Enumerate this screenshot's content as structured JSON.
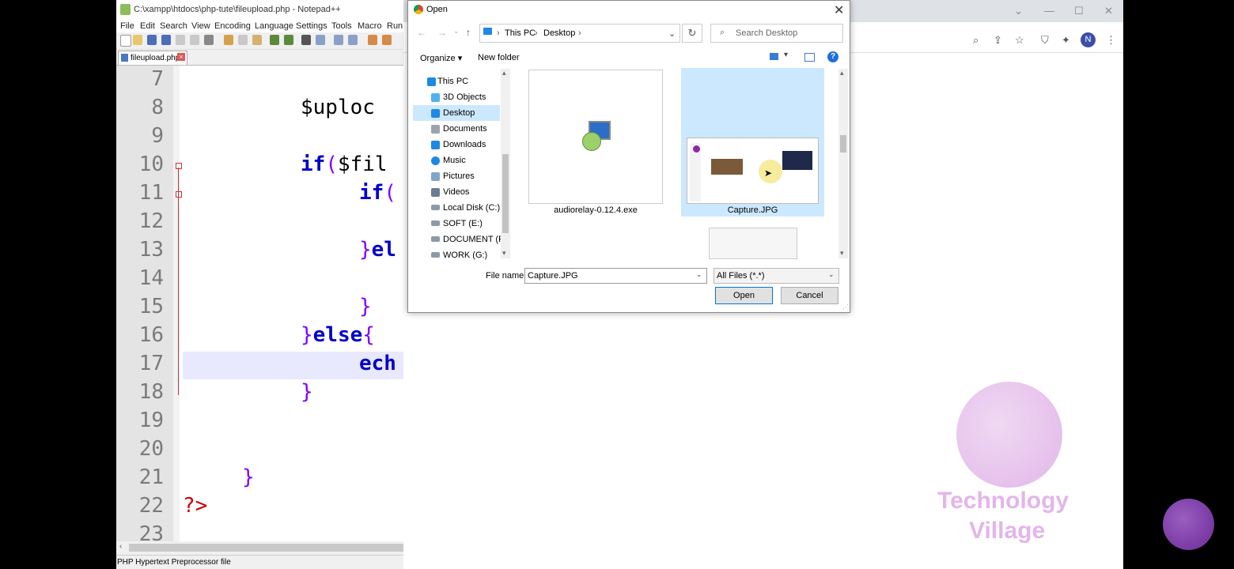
{
  "npp": {
    "title": "C:\\xampp\\htdocs\\php-tute\\fileupload.php - Notepad++",
    "menu": [
      "File",
      "Edit",
      "Search",
      "View",
      "Encoding",
      "Language",
      "Settings",
      "Tools",
      "Macro",
      "Run"
    ],
    "tab": "fileupload.php",
    "lines": [
      "7",
      "8",
      "9",
      "10",
      "11",
      "12",
      "13",
      "14",
      "15",
      "16",
      "17",
      "18",
      "19",
      "20",
      "21",
      "22",
      "23"
    ],
    "status": "PHP Hypertext Preprocessor file"
  },
  "chrome": {
    "avatar": "N"
  },
  "dialog": {
    "title": "Open",
    "breadcrumb": [
      "This PC",
      "Desktop"
    ],
    "search_placeholder": "Search Desktop",
    "organize": "Organize",
    "new_folder": "New folder",
    "sidebar": [
      "This PC",
      "3D Objects",
      "Desktop",
      "Documents",
      "Downloads",
      "Music",
      "Pictures",
      "Videos",
      "Local Disk (C:)",
      "SOFT (E:)",
      "DOCUMENT (F:)",
      "WORK (G:)"
    ],
    "files": [
      "audiorelay-0.12.4.exe",
      "Capture.JPG"
    ],
    "filename_label": "File name:",
    "filename": "Capture.JPG",
    "filetype": "All Files (*.*)",
    "open": "Open",
    "cancel": "Cancel"
  },
  "watermark": {
    "line1": "Technology",
    "line2": "Village"
  }
}
